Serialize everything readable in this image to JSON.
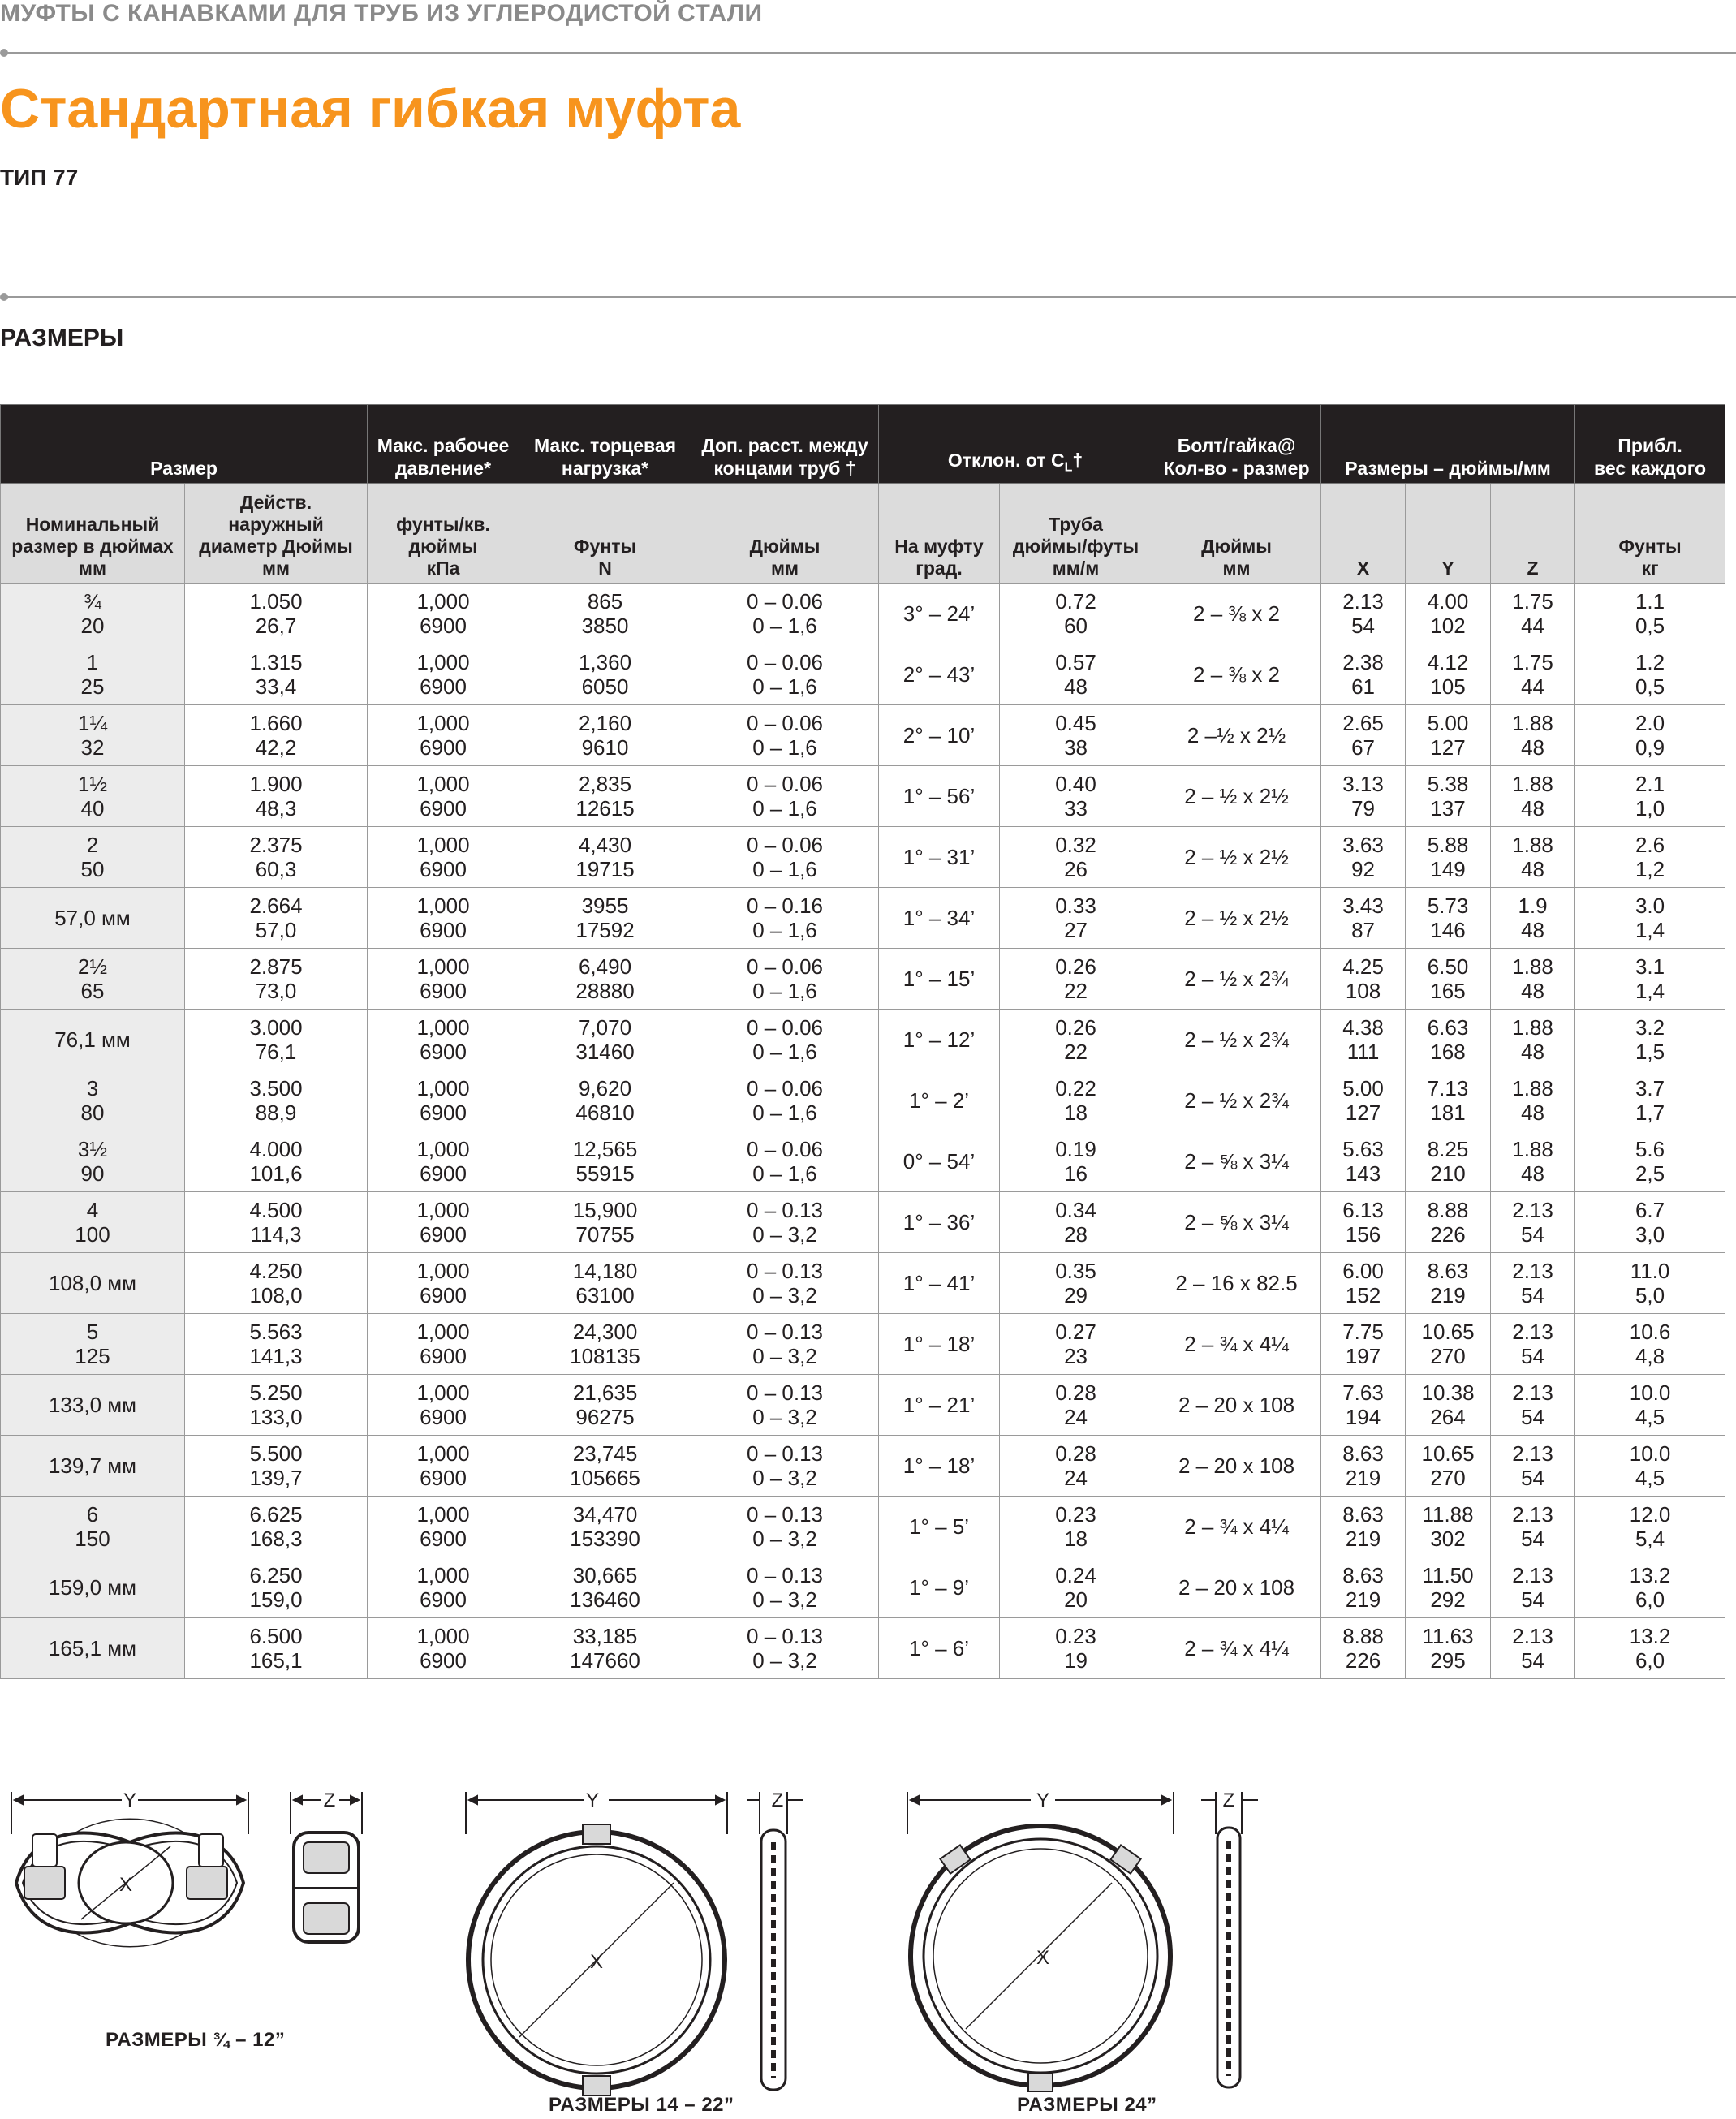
{
  "header": {
    "section": "МУФТЫ С КАНАВКАМИ ДЛЯ ТРУБ ИЗ УГЛЕРОДИСТОЙ СТАЛИ",
    "title": "Стандартная гибкая муфта",
    "subtitle": "ТИП 77",
    "dimensions_label": "РАЗМЕРЫ"
  },
  "table": {
    "group_headers": {
      "size": "Размер",
      "pressure": [
        "Макс. рабочее",
        "давление*"
      ],
      "endload": [
        "Макс. торцевая",
        "нагрузка*"
      ],
      "gap": [
        "Доп. расст. между",
        "концами труб †"
      ],
      "deflection": "Отклон. от C",
      "deflection_sub": "L",
      "deflection_tail": "†",
      "bolt": [
        "Болт/гайка@",
        "Кол-во - размер"
      ],
      "dims": "Размеры – дюймы/мм",
      "weight": [
        "Прибл.",
        "вес каждого"
      ]
    },
    "sub_headers": [
      [
        "Номинальный",
        "размер в дюймах",
        "мм"
      ],
      [
        "Действ.",
        "наружный",
        "диаметр Дюймы",
        "мм"
      ],
      [
        "фунты/кв.",
        "дюймы",
        "кПа"
      ],
      [
        "Фунты",
        "N"
      ],
      [
        "Дюймы",
        "мм"
      ],
      [
        "На муфту",
        "град."
      ],
      [
        "Труба",
        "дюймы/футы",
        "мм/м"
      ],
      [
        "Дюймы",
        "мм"
      ],
      [
        "X"
      ],
      [
        "Y"
      ],
      [
        "Z"
      ],
      [
        "Фунты",
        "кг"
      ]
    ],
    "rows": [
      [
        [
          "¾",
          "20"
        ],
        [
          "1.050",
          "26,7"
        ],
        [
          "1,000",
          "6900"
        ],
        [
          "865",
          "3850"
        ],
        [
          "0 – 0.06",
          "0 – 1,6"
        ],
        [
          "3° – 24’"
        ],
        [
          "0.72",
          "60"
        ],
        [
          "2 – ⅜ x 2"
        ],
        [
          "2.13",
          "54"
        ],
        [
          "4.00",
          "102"
        ],
        [
          "1.75",
          "44"
        ],
        [
          "1.1",
          "0,5"
        ]
      ],
      [
        [
          "1",
          "25"
        ],
        [
          "1.315",
          "33,4"
        ],
        [
          "1,000",
          "6900"
        ],
        [
          "1,360",
          "6050"
        ],
        [
          "0 – 0.06",
          "0 – 1,6"
        ],
        [
          "2° – 43’"
        ],
        [
          "0.57",
          "48"
        ],
        [
          "2 – ⅜ x 2"
        ],
        [
          "2.38",
          "61"
        ],
        [
          "4.12",
          "105"
        ],
        [
          "1.75",
          "44"
        ],
        [
          "1.2",
          "0,5"
        ]
      ],
      [
        [
          "1¼",
          "32"
        ],
        [
          "1.660",
          "42,2"
        ],
        [
          "1,000",
          "6900"
        ],
        [
          "2,160",
          "9610"
        ],
        [
          "0 – 0.06",
          "0 – 1,6"
        ],
        [
          "2° – 10’"
        ],
        [
          "0.45",
          "38"
        ],
        [
          "2 –½ x 2½"
        ],
        [
          "2.65",
          "67"
        ],
        [
          "5.00",
          "127"
        ],
        [
          "1.88",
          "48"
        ],
        [
          "2.0",
          "0,9"
        ]
      ],
      [
        [
          "1½",
          "40"
        ],
        [
          "1.900",
          "48,3"
        ],
        [
          "1,000",
          "6900"
        ],
        [
          "2,835",
          "12615"
        ],
        [
          "0 – 0.06",
          "0 – 1,6"
        ],
        [
          "1° – 56’"
        ],
        [
          "0.40",
          "33"
        ],
        [
          "2 – ½ x 2½"
        ],
        [
          "3.13",
          "79"
        ],
        [
          "5.38",
          "137"
        ],
        [
          "1.88",
          "48"
        ],
        [
          "2.1",
          "1,0"
        ]
      ],
      [
        [
          "2",
          "50"
        ],
        [
          "2.375",
          "60,3"
        ],
        [
          "1,000",
          "6900"
        ],
        [
          "4,430",
          "19715"
        ],
        [
          "0 – 0.06",
          "0 – 1,6"
        ],
        [
          "1° – 31’"
        ],
        [
          "0.32",
          "26"
        ],
        [
          "2 – ½ x 2½"
        ],
        [
          "3.63",
          "92"
        ],
        [
          "5.88",
          "149"
        ],
        [
          "1.88",
          "48"
        ],
        [
          "2.6",
          "1,2"
        ]
      ],
      [
        [
          "57,0 мм"
        ],
        [
          "2.664",
          "57,0"
        ],
        [
          "1,000",
          "6900"
        ],
        [
          "3955",
          "17592"
        ],
        [
          "0 – 0.16",
          "0 – 1,6"
        ],
        [
          "1° – 34’"
        ],
        [
          "0.33",
          "27"
        ],
        [
          "2 – ½ x 2½"
        ],
        [
          "3.43",
          "87"
        ],
        [
          "5.73",
          "146"
        ],
        [
          "1.9",
          "48"
        ],
        [
          "3.0",
          "1,4"
        ]
      ],
      [
        [
          "2½",
          "65"
        ],
        [
          "2.875",
          "73,0"
        ],
        [
          "1,000",
          "6900"
        ],
        [
          "6,490",
          "28880"
        ],
        [
          "0 – 0.06",
          "0 – 1,6"
        ],
        [
          "1° – 15’"
        ],
        [
          "0.26",
          "22"
        ],
        [
          "2 – ½ x 2¾"
        ],
        [
          "4.25",
          "108"
        ],
        [
          "6.50",
          "165"
        ],
        [
          "1.88",
          "48"
        ],
        [
          "3.1",
          "1,4"
        ]
      ],
      [
        [
          "76,1 мм"
        ],
        [
          "3.000",
          "76,1"
        ],
        [
          "1,000",
          "6900"
        ],
        [
          "7,070",
          "31460"
        ],
        [
          "0 – 0.06",
          "0 – 1,6"
        ],
        [
          "1° – 12’"
        ],
        [
          "0.26",
          "22"
        ],
        [
          "2 – ½ x 2¾"
        ],
        [
          "4.38",
          "111"
        ],
        [
          "6.63",
          "168"
        ],
        [
          "1.88",
          "48"
        ],
        [
          "3.2",
          "1,5"
        ]
      ],
      [
        [
          "3",
          "80"
        ],
        [
          "3.500",
          "88,9"
        ],
        [
          "1,000",
          "6900"
        ],
        [
          "9,620",
          "46810"
        ],
        [
          "0 – 0.06",
          "0 – 1,6"
        ],
        [
          "1° – 2’"
        ],
        [
          "0.22",
          "18"
        ],
        [
          "2 – ½ x 2¾"
        ],
        [
          "5.00",
          "127"
        ],
        [
          "7.13",
          "181"
        ],
        [
          "1.88",
          "48"
        ],
        [
          "3.7",
          "1,7"
        ]
      ],
      [
        [
          "3½",
          "90"
        ],
        [
          "4.000",
          "101,6"
        ],
        [
          "1,000",
          "6900"
        ],
        [
          "12,565",
          "55915"
        ],
        [
          "0 – 0.06",
          "0 – 1,6"
        ],
        [
          "0° – 54’"
        ],
        [
          "0.19",
          "16"
        ],
        [
          "2 – ⅝ x 3¼"
        ],
        [
          "5.63",
          "143"
        ],
        [
          "8.25",
          "210"
        ],
        [
          "1.88",
          "48"
        ],
        [
          "5.6",
          "2,5"
        ]
      ],
      [
        [
          "4",
          "100"
        ],
        [
          "4.500",
          "114,3"
        ],
        [
          "1,000",
          "6900"
        ],
        [
          "15,900",
          "70755"
        ],
        [
          "0 – 0.13",
          "0 – 3,2"
        ],
        [
          "1° – 36’"
        ],
        [
          "0.34",
          "28"
        ],
        [
          "2 – ⅝ x 3¼"
        ],
        [
          "6.13",
          "156"
        ],
        [
          "8.88",
          "226"
        ],
        [
          "2.13",
          "54"
        ],
        [
          "6.7",
          "3,0"
        ]
      ],
      [
        [
          "108,0 мм"
        ],
        [
          "4.250",
          "108,0"
        ],
        [
          "1,000",
          "6900"
        ],
        [
          "14,180",
          "63100"
        ],
        [
          "0 – 0.13",
          "0 – 3,2"
        ],
        [
          "1° – 41’"
        ],
        [
          "0.35",
          "29"
        ],
        [
          "2 – 16 x 82.5"
        ],
        [
          "6.00",
          "152"
        ],
        [
          "8.63",
          "219"
        ],
        [
          "2.13",
          "54"
        ],
        [
          "11.0",
          "5,0"
        ]
      ],
      [
        [
          "5",
          "125"
        ],
        [
          "5.563",
          "141,3"
        ],
        [
          "1,000",
          "6900"
        ],
        [
          "24,300",
          "108135"
        ],
        [
          "0 – 0.13",
          "0 – 3,2"
        ],
        [
          "1° – 18’"
        ],
        [
          "0.27",
          "23"
        ],
        [
          "2 – ¾ x 4¼"
        ],
        [
          "7.75",
          "197"
        ],
        [
          "10.65",
          "270"
        ],
        [
          "2.13",
          "54"
        ],
        [
          "10.6",
          "4,8"
        ]
      ],
      [
        [
          "133,0 мм"
        ],
        [
          "5.250",
          "133,0"
        ],
        [
          "1,000",
          "6900"
        ],
        [
          "21,635",
          "96275"
        ],
        [
          "0 – 0.13",
          "0 – 3,2"
        ],
        [
          "1° – 21’"
        ],
        [
          "0.28",
          "24"
        ],
        [
          "2 – 20 x 108"
        ],
        [
          "7.63",
          "194"
        ],
        [
          "10.38",
          "264"
        ],
        [
          "2.13",
          "54"
        ],
        [
          "10.0",
          "4,5"
        ]
      ],
      [
        [
          "139,7 мм"
        ],
        [
          "5.500",
          "139,7"
        ],
        [
          "1,000",
          "6900"
        ],
        [
          "23,745",
          "105665"
        ],
        [
          "0 – 0.13",
          "0 – 3,2"
        ],
        [
          "1° – 18’"
        ],
        [
          "0.28",
          "24"
        ],
        [
          "2 – 20 x 108"
        ],
        [
          "8.63",
          "219"
        ],
        [
          "10.65",
          "270"
        ],
        [
          "2.13",
          "54"
        ],
        [
          "10.0",
          "4,5"
        ]
      ],
      [
        [
          "6",
          "150"
        ],
        [
          "6.625",
          "168,3"
        ],
        [
          "1,000",
          "6900"
        ],
        [
          "34,470",
          "153390"
        ],
        [
          "0 – 0.13",
          "0 – 3,2"
        ],
        [
          "1° – 5’"
        ],
        [
          "0.23",
          "18"
        ],
        [
          "2 – ¾ x 4¼"
        ],
        [
          "8.63",
          "219"
        ],
        [
          "11.88",
          "302"
        ],
        [
          "2.13",
          "54"
        ],
        [
          "12.0",
          "5,4"
        ]
      ],
      [
        [
          "159,0 мм"
        ],
        [
          "6.250",
          "159,0"
        ],
        [
          "1,000",
          "6900"
        ],
        [
          "30,665",
          "136460"
        ],
        [
          "0 – 0.13",
          "0 – 3,2"
        ],
        [
          "1° – 9’"
        ],
        [
          "0.24",
          "20"
        ],
        [
          "2 – 20 x 108"
        ],
        [
          "8.63",
          "219"
        ],
        [
          "11.50",
          "292"
        ],
        [
          "2.13",
          "54"
        ],
        [
          "13.2",
          "6,0"
        ]
      ],
      [
        [
          "165,1 мм"
        ],
        [
          "6.500",
          "165,1"
        ],
        [
          "1,000",
          "6900"
        ],
        [
          "33,185",
          "147660"
        ],
        [
          "0 – 0.13",
          "0 – 3,2"
        ],
        [
          "1° – 6’"
        ],
        [
          "0.23",
          "19"
        ],
        [
          "2 – ¾ x 4¼"
        ],
        [
          "8.88",
          "226"
        ],
        [
          "11.63",
          "295"
        ],
        [
          "2.13",
          "54"
        ],
        [
          "13.2",
          "6,0"
        ]
      ]
    ]
  },
  "figures": {
    "letters": {
      "x": "X",
      "y": "Y",
      "z": "Z"
    },
    "captions": [
      "РАЗМЕРЫ ¾ – 12”",
      "РАЗМЕРЫ 14 – 22”",
      "РАЗМЕРЫ 24”"
    ]
  },
  "colors": {
    "accent": "#f7941d",
    "header_bg": "#231f20",
    "subheader_bg": "#dcdcdc",
    "rule": "#9a9a9a"
  }
}
